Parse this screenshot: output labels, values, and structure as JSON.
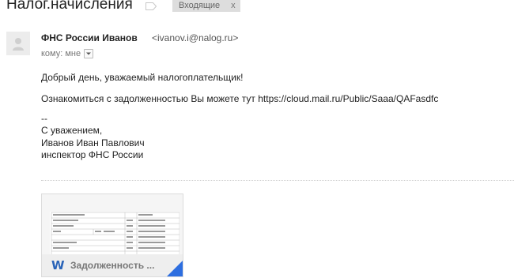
{
  "header": {
    "subject": "Налог.начисления",
    "label": "Входящие",
    "label_close": "x"
  },
  "message": {
    "sender_name": "ФНС России Иванов",
    "sender_email": "<ivanov.i@nalog.ru>",
    "to_label": "кому: мне"
  },
  "body": {
    "greeting": "Добрый день, уважаемый налогоплательщик!",
    "notice": "Ознакомиться с задолженностью Вы можете тут https://cloud.mail.ru/Public/Saaa/QAFasdfc",
    "sig_dash": "--",
    "sig_regards": "С уважением,",
    "sig_name": "Иванов Иван Павлович",
    "sig_title": "инспектор ФНС России"
  },
  "attachment": {
    "name": "Задолженность ...",
    "icon": "word-icon",
    "icon_glyph": "W",
    "accent": "#2d6ee0"
  }
}
